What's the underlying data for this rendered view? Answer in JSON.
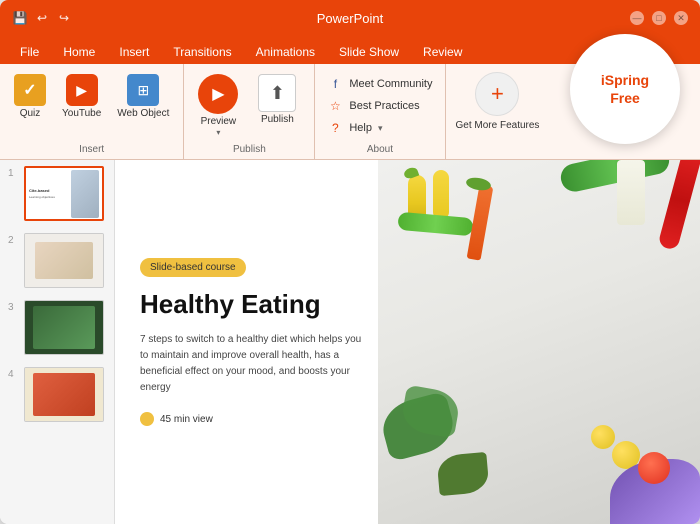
{
  "window": {
    "title": "PowerPoint",
    "controls": {
      "minimize": "—",
      "maximize": "□",
      "close": "✕"
    }
  },
  "quickaccess": {
    "save_label": "💾",
    "undo_label": "↩",
    "redo_label": "↪"
  },
  "tabs": [
    {
      "label": "File"
    },
    {
      "label": "Home"
    },
    {
      "label": "Insert"
    },
    {
      "label": "Transitions"
    },
    {
      "label": "Animations"
    },
    {
      "label": "Slide Show"
    },
    {
      "label": "Review"
    }
  ],
  "ribbon": {
    "insert_group": {
      "label": "Insert",
      "quiz_label": "Quiz",
      "youtube_label": "YouTube",
      "web_label": "Web Object"
    },
    "publish_group": {
      "label": "Publish",
      "preview_label": "Preview",
      "publish_label": "Publish"
    },
    "about_group": {
      "label": "About",
      "meet_label": "Meet Community",
      "best_label": "Best Practices",
      "help_label": "Help"
    },
    "getmore": {
      "label": "Get More Features",
      "icon": "+"
    }
  },
  "ispring": {
    "badge_line1": "iSpring",
    "badge_line2": "Free"
  },
  "slides": [
    {
      "number": "1"
    },
    {
      "number": "2"
    },
    {
      "number": "3"
    },
    {
      "number": "4"
    }
  ],
  "main_slide": {
    "badge": "Slide-based course",
    "title": "Healthy Eating",
    "description": "7 steps to switch to a healthy diet which helps you to maintain and improve overall health, has a beneficial effect on your mood, and boosts your energy",
    "duration": "45 min view"
  }
}
